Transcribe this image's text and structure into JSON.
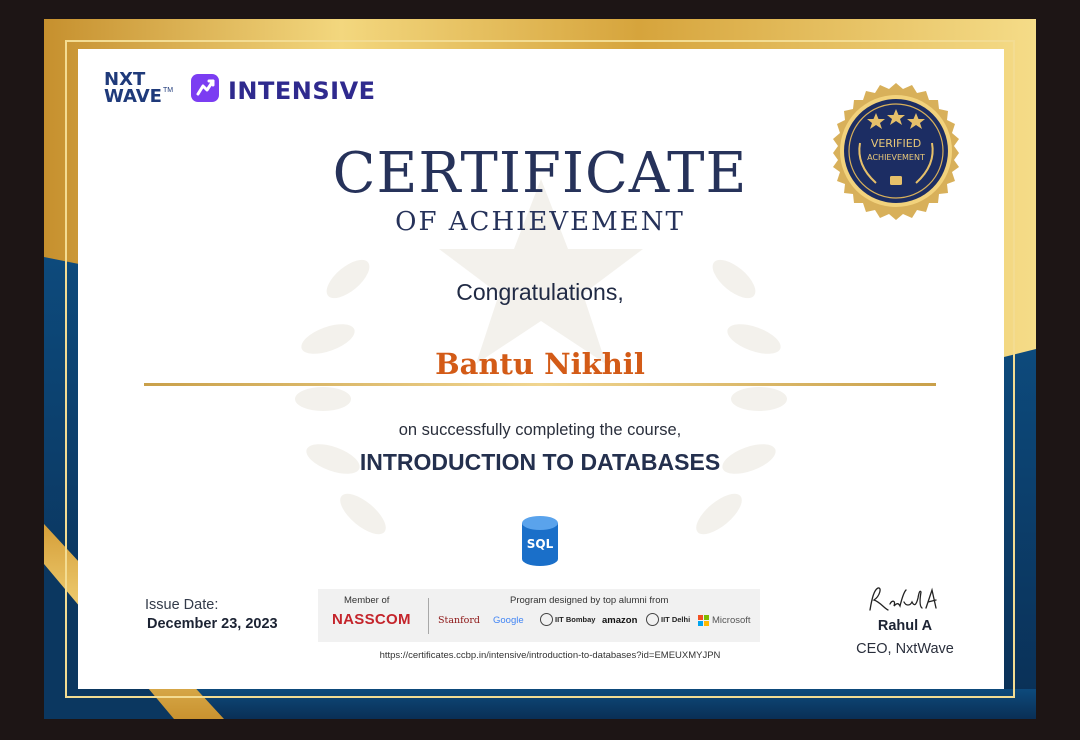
{
  "branding": {
    "nxt_line1": "NXT",
    "nxt_line2": "WAVE",
    "trademark": "TM",
    "program": "INTENSIVE"
  },
  "certificate": {
    "title": "CERTIFICATE",
    "subtitle": "OF ACHIEVEMENT",
    "greeting": "Congratulations,",
    "recipient": "Bantu Nikhil",
    "completion_text": "on successfully completing the course,",
    "course": "INTRODUCTION TO DATABASES",
    "course_icon_label": "SQL"
  },
  "seal": {
    "line1": "VERIFIED",
    "line2": "ACHIEVEMENT"
  },
  "issue": {
    "label": "Issue Date:",
    "date": "December 23, 2023"
  },
  "affiliations": {
    "member_label": "Member of",
    "member": "NASSCOM",
    "designed_label": "Program designed by top alumni from",
    "partners": [
      "Stanford",
      "Google",
      "IIT Bombay",
      "amazon",
      "IIT Delhi",
      "Microsoft"
    ]
  },
  "verification_url": "https://certificates.ccbp.in/intensive/introduction-to-databases?id=EMEUXMYJPN",
  "signatory": {
    "name": "Rahul A",
    "title": "CEO, NxtWave"
  },
  "colors": {
    "navy": "#26325a",
    "gold": "#d8ad4b",
    "blue_band": "#0f4a78",
    "name_orange": "#d35b17"
  }
}
